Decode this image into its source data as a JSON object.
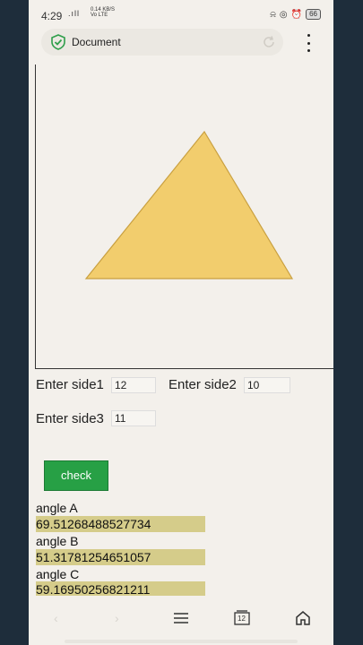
{
  "status_bar": {
    "time": "4:29",
    "signal": ".ıll",
    "net_speed": "0.14 KB/S",
    "net_type": "Vo LTE",
    "battery": "66"
  },
  "browser": {
    "tab_title": "Document",
    "icons": [
      "shield-check-icon",
      "reload-icon",
      "kebab-menu-icon"
    ]
  },
  "canvas": {
    "triangle_fill": "#f2cd6d",
    "triangle_stroke": "#c9a040",
    "vertices": {
      "apex": [
        227,
        147
      ],
      "left": [
        95,
        311
      ],
      "right": [
        325,
        311
      ]
    }
  },
  "form": {
    "side1_label": "Enter side1",
    "side1_value": "12",
    "side2_label": "Enter side2",
    "side2_value": "10",
    "side3_label": "Enter side3",
    "side3_value": "11",
    "check_label": "check"
  },
  "results": {
    "angle_a_label": "angle A",
    "angle_a_value": "69.51268488527734",
    "angle_b_label": "angle B",
    "angle_b_value": "51.31781254651057",
    "angle_c_label": "angle C",
    "angle_c_value": "59.16950256821211"
  },
  "navbar": {
    "tab_count": "12",
    "icons": [
      "back-icon",
      "forward-icon",
      "menu-icon",
      "tabs-icon",
      "home-icon"
    ]
  },
  "colors": {
    "accent_button": "#27a045",
    "result_highlight": "#d5cc8a",
    "page_bg": "#f3f0eb"
  }
}
